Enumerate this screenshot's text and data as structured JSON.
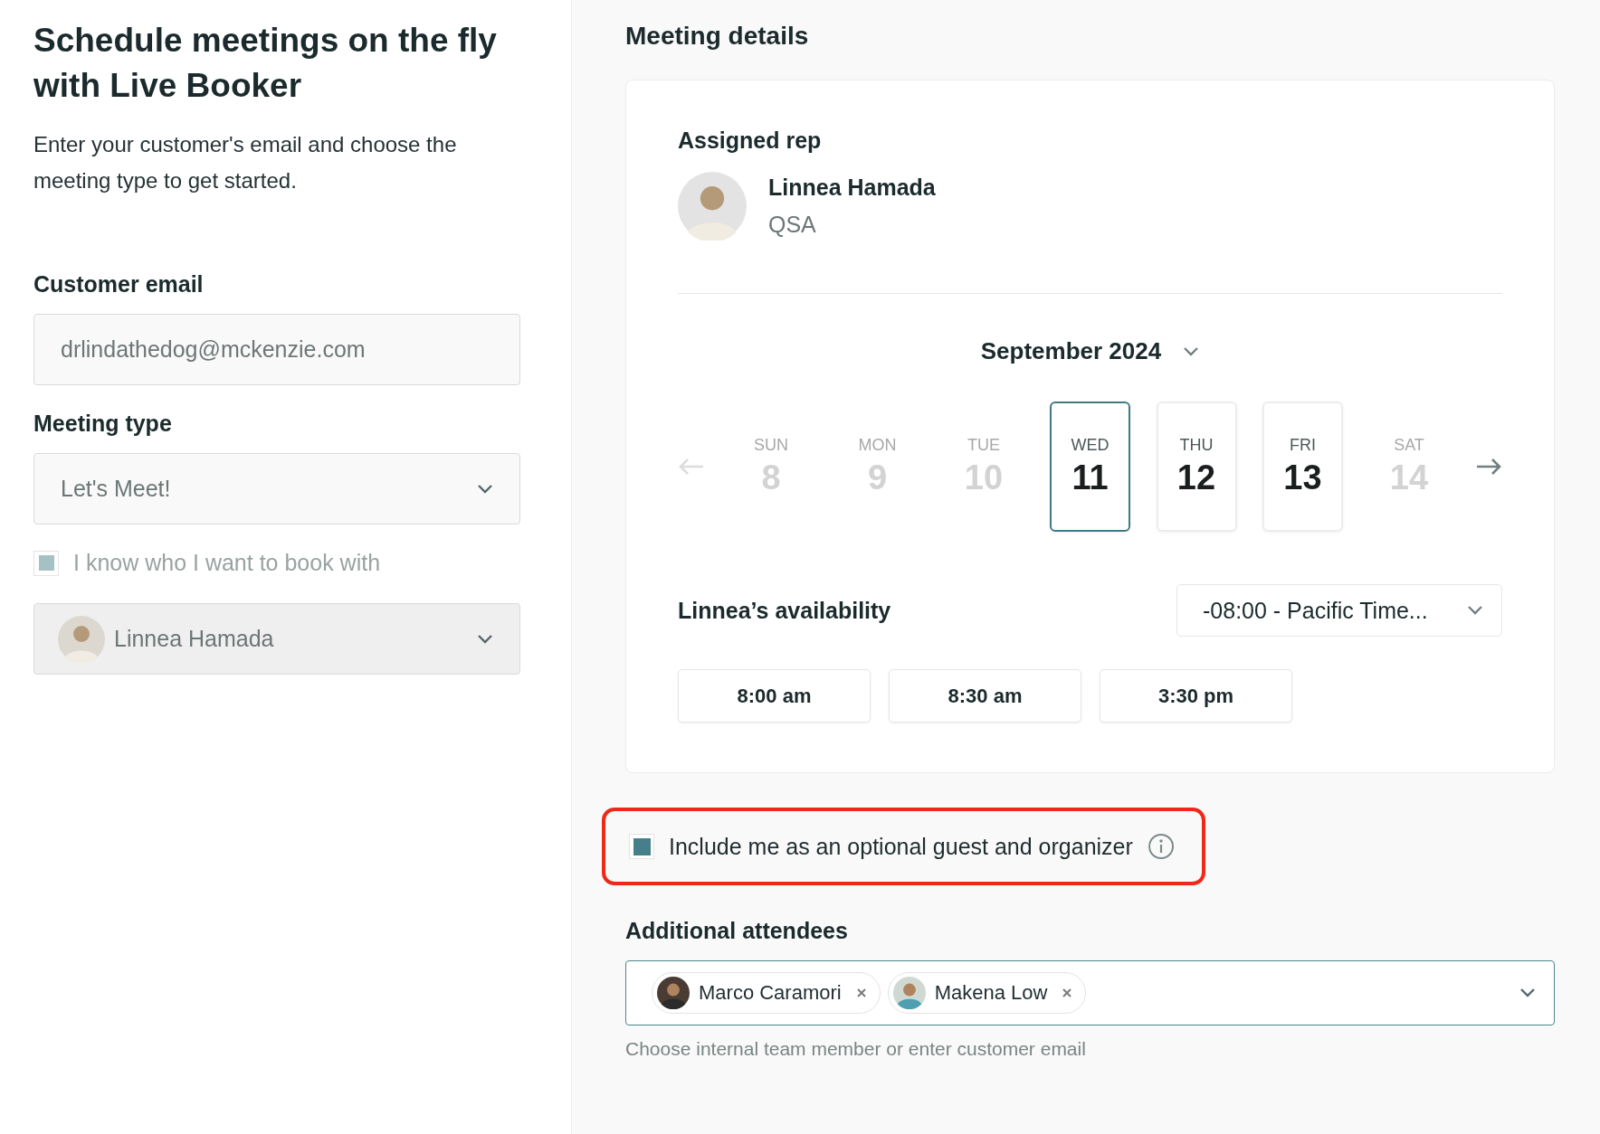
{
  "intro": {
    "title": "Schedule meetings on the fly with Live Booker",
    "description": "Enter your customer's email and choose the meeting type to get started."
  },
  "customer_email": {
    "label": "Customer email",
    "value": "drlindathedog@mckenzie.com"
  },
  "meeting_type": {
    "label": "Meeting type",
    "value": "Let's Meet!"
  },
  "know_who": {
    "label": "I know who I want to book with",
    "checked": true,
    "disabled": true
  },
  "rep_select": {
    "value": "Linnea Hamada"
  },
  "meeting_details": {
    "title": "Meeting details",
    "assigned_rep": {
      "label": "Assigned rep",
      "name": "Linnea Hamada",
      "role": "QSA"
    },
    "month": "September 2024",
    "days": [
      {
        "weekday": "SUN",
        "day": "8",
        "available": false,
        "selected": false
      },
      {
        "weekday": "MON",
        "day": "9",
        "available": false,
        "selected": false
      },
      {
        "weekday": "TUE",
        "day": "10",
        "available": false,
        "selected": false
      },
      {
        "weekday": "WED",
        "day": "11",
        "available": true,
        "selected": true
      },
      {
        "weekday": "THU",
        "day": "12",
        "available": true,
        "selected": false
      },
      {
        "weekday": "FRI",
        "day": "13",
        "available": true,
        "selected": false
      },
      {
        "weekday": "SAT",
        "day": "14",
        "available": false,
        "selected": false
      }
    ],
    "prev_disabled": true,
    "availability_label": "Linnea’s availability",
    "timezone": "-08:00 - Pacific Time...",
    "times": [
      "8:00 am",
      "8:30 am",
      "3:30 pm"
    ]
  },
  "include_me": {
    "label": "Include me as an optional guest and organizer",
    "checked": true,
    "highlighted": true
  },
  "attendees": {
    "label": "Additional attendees",
    "chips": [
      {
        "name": "Marco Caramori"
      },
      {
        "name": "Makena Low"
      }
    ],
    "hint": "Choose internal team member or enter customer email"
  }
}
